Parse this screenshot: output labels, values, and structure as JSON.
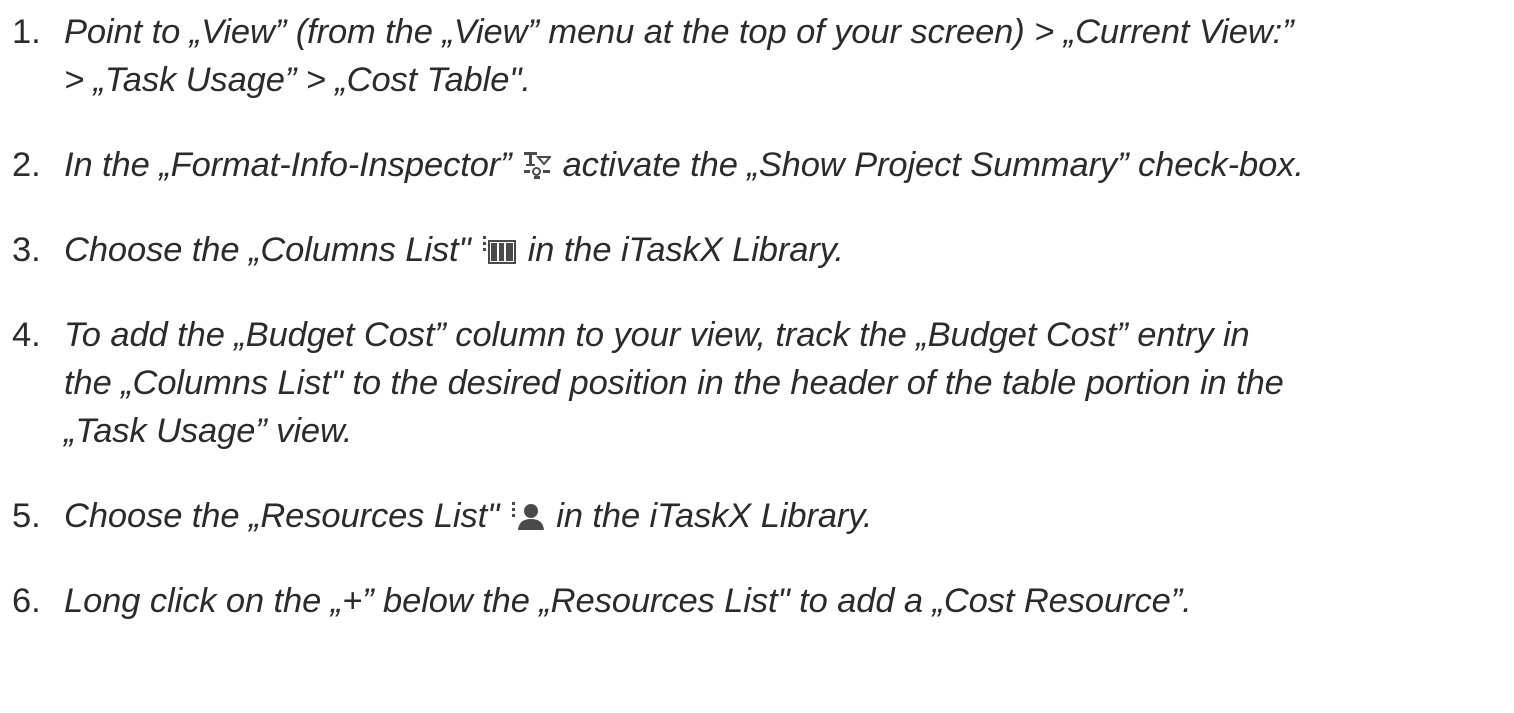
{
  "steps": [
    {
      "number": "1.",
      "lines": [
        "Point to „View” (from the „View” menu at the top of your screen) > „Current View:”",
        "> „Task Usage” > „Cost Table\"."
      ]
    },
    {
      "number": "2.",
      "before": "In the „Format-Info-Inspector”",
      "icon": "format-info-inspector-icon",
      "after": "activate the „Show Project Summary” check-box."
    },
    {
      "number": "3.",
      "before": "Choose the „Columns List\"",
      "icon": "columns-list-icon",
      "after": "in the iTaskX Library."
    },
    {
      "number": "4.",
      "lines": [
        "To add the „Budget Cost” column to your view, track the „Budget Cost” entry in",
        "the „Columns List\" to the desired position in the header of the table portion in the",
        "„Task Usage” view."
      ]
    },
    {
      "number": "5.",
      "before": "Choose the „Resources List\"",
      "icon": "resources-list-icon",
      "after": "in the iTaskX Library."
    },
    {
      "number": "6.",
      "lines": [
        "Long click on the „+” below the „Resources List\" to add a „Cost Resource”."
      ]
    }
  ],
  "colors": {
    "text": "#2b2b2b",
    "icon": "#4a4a4a"
  }
}
